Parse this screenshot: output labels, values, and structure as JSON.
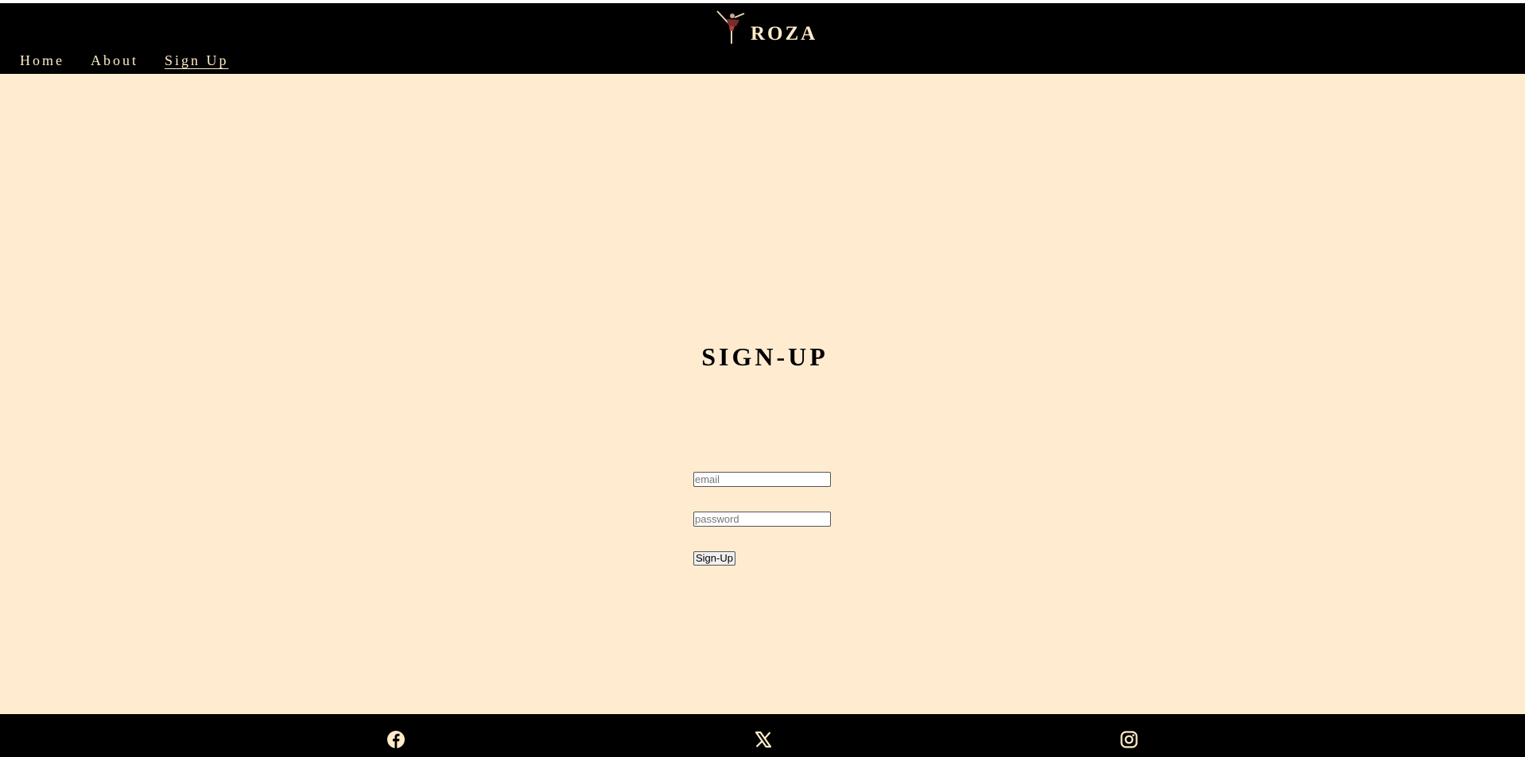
{
  "header": {
    "brand_name": "ROZA",
    "logo_icon": "dancer-logo-icon"
  },
  "nav": {
    "items": [
      {
        "label": "Home",
        "active": false
      },
      {
        "label": "About",
        "active": false
      },
      {
        "label": "Sign Up",
        "active": true
      }
    ]
  },
  "signup": {
    "title": "SIGN-UP",
    "email_placeholder": "email",
    "password_placeholder": "password",
    "submit_label": "Sign-Up"
  },
  "footer": {
    "icons": [
      "facebook-icon",
      "x-icon",
      "instagram-icon"
    ]
  },
  "colors": {
    "header_bg": "#000000",
    "accent_text": "#ffecc9",
    "main_bg": "#ffecd0",
    "footer_bg": "#000000"
  }
}
